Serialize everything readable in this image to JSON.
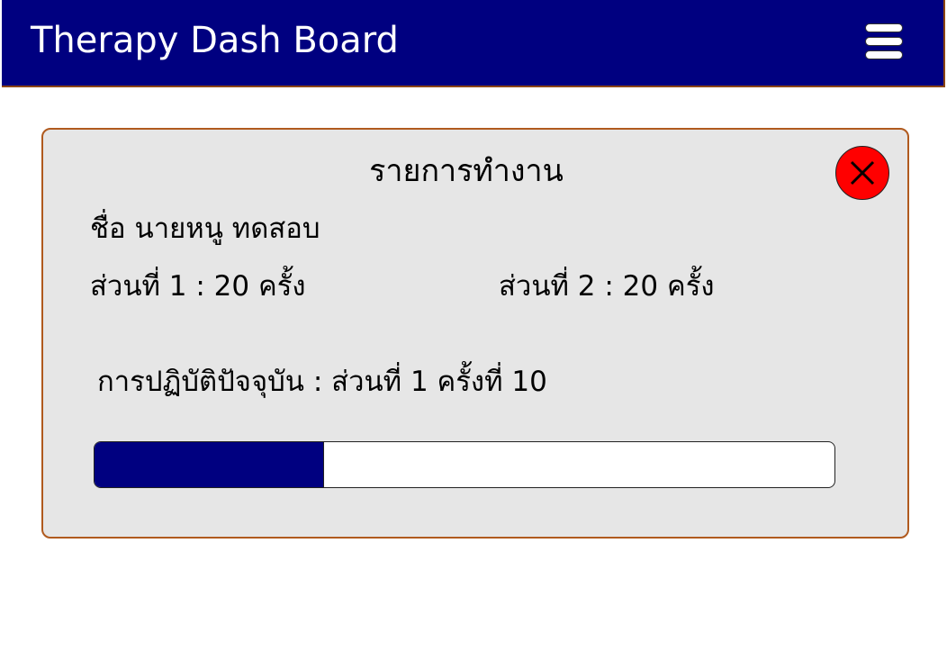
{
  "app": {
    "title": "Therapy Dash Board"
  },
  "colors": {
    "header_bg": "#000080",
    "card_bg": "#e6e6e6",
    "card_border": "#b05a1e",
    "close_button": "#ff0000",
    "progress_fill": "#000080"
  },
  "icons": {
    "menu": "hamburger-menu-icon",
    "close": "close-x-icon"
  },
  "card": {
    "title": "รายการทำงาน",
    "name_line": "ชื่อ นายหนู ทดสอบ",
    "part1": "ส่วนที่ 1 : 20 ครั้ง",
    "part2": "ส่วนที่ 2 : 20 ครั้ง",
    "current": "การปฏิบัติปัจจุบัน : ส่วนที่ 1 ครั้งที่ 10",
    "progress_percent": 31
  }
}
